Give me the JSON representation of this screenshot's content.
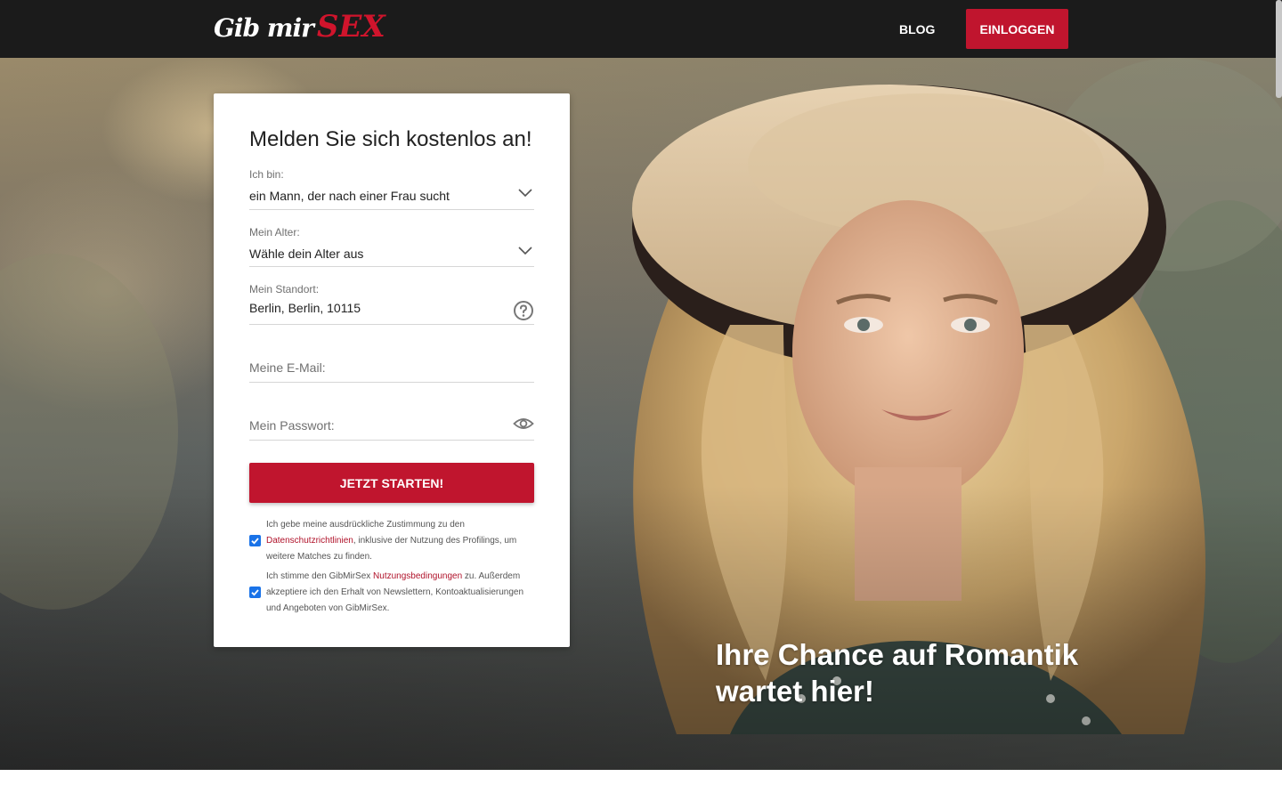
{
  "brand": {
    "name_part1": "Gib mir",
    "name_part2": "SEX"
  },
  "header": {
    "blog_label": "BLOG",
    "login_label": "EINLOGGEN"
  },
  "form": {
    "title": "Melden Sie sich kostenlos an!",
    "gender": {
      "label": "Ich bin:",
      "value": "ein Mann, der nach einer Frau sucht"
    },
    "age": {
      "label": "Mein Alter:",
      "value": "Wähle dein Alter aus"
    },
    "location": {
      "label": "Mein Standort:",
      "value": "Berlin, Berlin, 10115"
    },
    "email": {
      "placeholder": "Meine E-Mail:"
    },
    "password": {
      "placeholder": "Mein Passwort:"
    },
    "submit_label": "JETZT STARTEN!",
    "consent1": {
      "checked": true,
      "text_before": "Ich gebe meine ausdrückliche Zustimmung zu den ",
      "link": "Datenschutzrichtlinien",
      "text_after": ", inklusive der Nutzung des Profilings, um weitere Matches zu finden."
    },
    "consent2": {
      "checked": true,
      "text_before": "Ich stimme den GibMirSex ",
      "link": "Nutzungsbedingungen",
      "text_after": " zu. Außerdem akzeptiere ich den Erhalt von Newslettern, Kontoaktualisierungen und Angeboten von GibMirSex."
    }
  },
  "hero": {
    "headline": "Ihre Chance auf Romantik wartet hier!"
  },
  "colors": {
    "brand_red": "#c0152e",
    "header_bg": "#1b1b1b",
    "checkbox_blue": "#1a73e8"
  }
}
